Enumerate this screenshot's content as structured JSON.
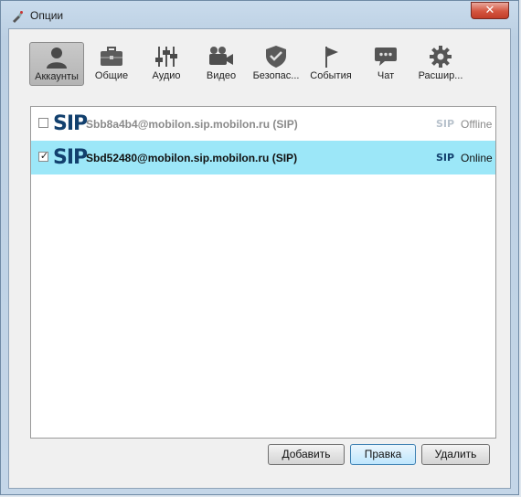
{
  "window": {
    "title": "Опции",
    "close_glyph": "✕"
  },
  "toolbar": {
    "items": [
      {
        "label": "Аккаунты",
        "icon": "user-icon",
        "active": true
      },
      {
        "label": "Общие",
        "icon": "briefcase-icon",
        "active": false
      },
      {
        "label": "Аудио",
        "icon": "sliders-icon",
        "active": false
      },
      {
        "label": "Видео",
        "icon": "video-camera-icon",
        "active": false
      },
      {
        "label": "Безопас...",
        "icon": "shield-icon",
        "active": false
      },
      {
        "label": "События",
        "icon": "flag-icon",
        "active": false
      },
      {
        "label": "Чат",
        "icon": "chat-bubble-icon",
        "active": false
      },
      {
        "label": "Расшир...",
        "icon": "gear-icon",
        "active": false
      }
    ]
  },
  "accounts": [
    {
      "enabled": false,
      "logo": "SIP",
      "name": "Sbb8a4b4@mobilon.sip.mobilon.ru (SIP)",
      "protocol": "SIP",
      "status": "Offline",
      "selected": false
    },
    {
      "enabled": true,
      "logo": "SIP",
      "name": "Sbd52480@mobilon.sip.mobilon.ru (SIP)",
      "protocol": "SIP",
      "status": "Online",
      "selected": true
    }
  ],
  "buttons": {
    "add": "Добавить",
    "edit": "Правка",
    "delete": "Удалить"
  },
  "colors": {
    "sip_logo_online": "#12406e",
    "sip_logo_offline": "#a9b7c6",
    "selected_row": "#9ce7f8",
    "offline_text": "#8a8a8a",
    "online_text": "#111111"
  }
}
